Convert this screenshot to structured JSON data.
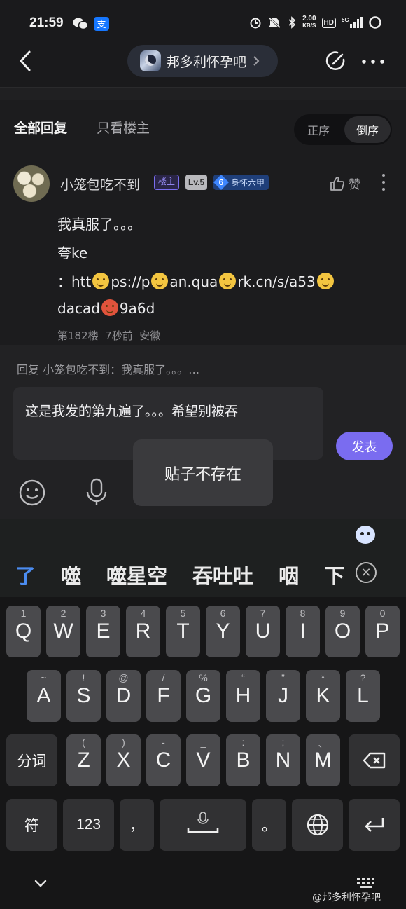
{
  "status": {
    "time": "21:59",
    "net_speed_value": "2.00",
    "net_speed_unit": "KB/S",
    "hd": "HD",
    "signal": "5G"
  },
  "nav": {
    "forum_name": "邦多利怀孕吧"
  },
  "tabs": {
    "all_replies": "全部回复",
    "op_only": "只看楼主",
    "order_asc": "正序",
    "order_desc": "倒序"
  },
  "post": {
    "username": "小笼包吃不到",
    "badge_op": "楼主",
    "badge_level": "Lv.5",
    "badge_preg_num": "6",
    "badge_preg_text": "身怀六甲",
    "like_label": "赞",
    "lines": [
      "我真服了。。。",
      "夸ke",
      [
        "：htt",
        "ps://p",
        "an.qua",
        "rk.cn/s/a53",
        ""
      ],
      [
        "dacad",
        "9a6d"
      ]
    ],
    "floor": "第182楼",
    "time_ago": "7秒前",
    "location": "安徽"
  },
  "composer": {
    "reply_hint": "回复 小笼包吃不到：我真服了。。。…",
    "text": "这是我发的第九遍了。。。希望别被吞",
    "send_label": "发表",
    "toast": "贴子不存在"
  },
  "keyboard": {
    "candidates": [
      "了",
      "噬",
      "噬星空",
      "吞吐吐",
      "咽",
      "下"
    ],
    "row1": [
      [
        "Q",
        "1"
      ],
      [
        "W",
        "2"
      ],
      [
        "E",
        "3"
      ],
      [
        "R",
        "4"
      ],
      [
        "T",
        "5"
      ],
      [
        "Y",
        "6"
      ],
      [
        "U",
        "7"
      ],
      [
        "I",
        "8"
      ],
      [
        "O",
        "9"
      ],
      [
        "P",
        "0"
      ]
    ],
    "row2": [
      [
        "A",
        "~"
      ],
      [
        "S",
        "!"
      ],
      [
        "D",
        "@"
      ],
      [
        "F",
        "/"
      ],
      [
        "G",
        "%"
      ],
      [
        "H",
        "“"
      ],
      [
        "J",
        "”"
      ],
      [
        "K",
        "*"
      ],
      [
        "L",
        "?"
      ]
    ],
    "row3": [
      [
        "Z",
        "("
      ],
      [
        "X",
        ")"
      ],
      [
        "C",
        "-"
      ],
      [
        "V",
        "_"
      ],
      [
        "B",
        ":"
      ],
      [
        "N",
        ";"
      ],
      [
        "M",
        "、"
      ]
    ],
    "segment_label": "分词",
    "symbols_label": "符",
    "numbers_label": "123",
    "comma": "，",
    "period": "。"
  },
  "watermark": "@邦多利怀孕吧"
}
